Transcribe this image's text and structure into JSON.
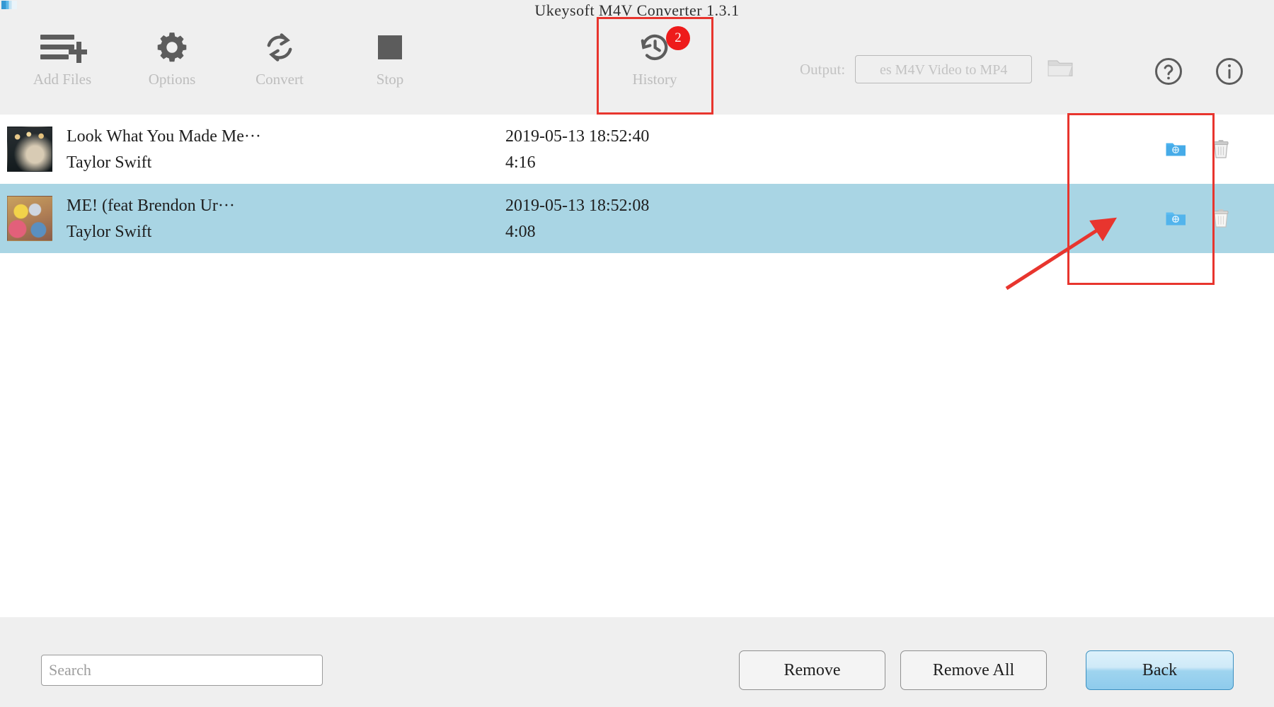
{
  "window": {
    "title": "Ukeysoft M4V Converter 1.3.1",
    "logo_icon": "app-logo-icon",
    "background": "#efefef"
  },
  "toolbar": {
    "items": [
      {
        "label": "Add Files",
        "icon": "add-files-icon",
        "enabled": false
      },
      {
        "label": "Options",
        "icon": "gear-icon",
        "enabled": false
      },
      {
        "label": "Convert",
        "icon": "convert-icon",
        "enabled": false
      },
      {
        "label": "Stop",
        "icon": "stop-icon",
        "enabled": false
      },
      {
        "label": "History",
        "icon": "history-icon",
        "enabled": true,
        "badge": "2"
      }
    ],
    "output": {
      "label": "Output:",
      "value": "es M4V Video to MP4",
      "placeholder": "es M4V Video to MP4",
      "browse_icon": "folder-open-icon"
    },
    "help_icon": "question-circle-icon",
    "info_icon": "info-circle-icon"
  },
  "list": {
    "columns": [
      "thumbnail",
      "title",
      "artist",
      "datetime",
      "duration",
      "actions"
    ],
    "rows": [
      {
        "thumbnail": "album-art-thumbnail",
        "title": "Look What You Made Me···",
        "artist": "Taylor Swift",
        "datetime": "2019-05-13 18:52:40",
        "duration": "4:16",
        "selected": false,
        "actions": [
          {
            "icon": "open-folder-icon",
            "name": "open-output-folder-button"
          },
          {
            "icon": "trash-icon",
            "name": "delete-record-button"
          }
        ]
      },
      {
        "thumbnail": "album-art-thumbnail",
        "title": "ME! (feat  Brendon Ur···",
        "artist": "Taylor Swift",
        "datetime": "2019-05-13 18:52:08",
        "duration": "4:08",
        "selected": true,
        "actions": [
          {
            "icon": "open-folder-icon",
            "name": "open-output-folder-button"
          },
          {
            "icon": "trash-icon",
            "name": "delete-record-button"
          }
        ]
      }
    ],
    "selected_row_color": "#a9d5e4"
  },
  "footer": {
    "search": {
      "value": "",
      "placeholder": "Search"
    },
    "buttons": [
      {
        "label": "Remove",
        "name": "remove-button",
        "primary": false
      },
      {
        "label": "Remove All",
        "name": "remove-all-button",
        "primary": false
      },
      {
        "label": "Back",
        "name": "back-button",
        "primary": true
      }
    ]
  },
  "annotations": {
    "accent_color": "#e8352e",
    "highlight_history": "history-button-highlight",
    "highlight_actions": "row-actions-highlight",
    "arrow": "pointer-arrow"
  }
}
